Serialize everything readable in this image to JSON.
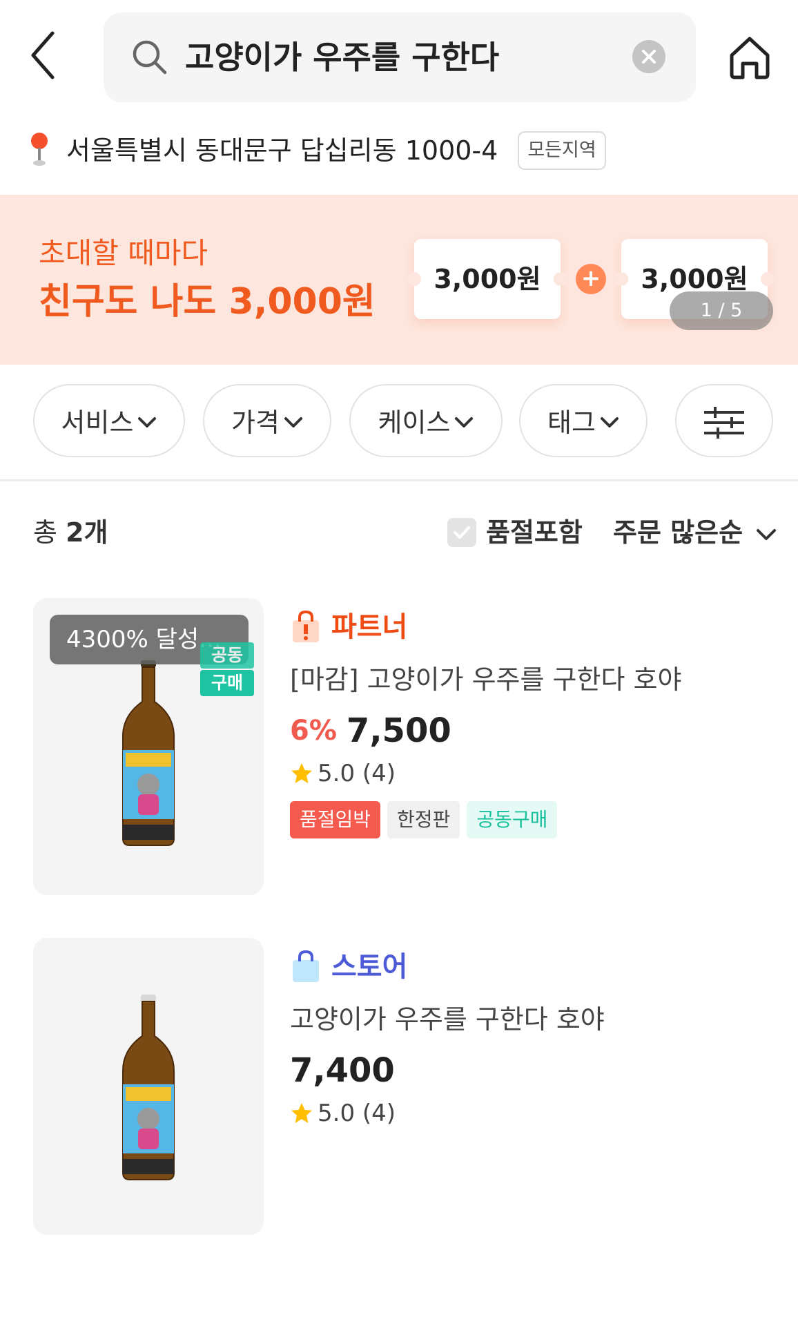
{
  "header": {
    "search_query": "고양이가 우주를 구한다"
  },
  "location": {
    "address": "서울특별시 동대문구 답십리동 1000-4",
    "region_button": "모든지역"
  },
  "banner": {
    "line1": "초대할 때마다",
    "line2": "친구도 나도 3,000원",
    "coupon_left": "3,000원",
    "coupon_right": "3,000원",
    "plus": "+",
    "page_indicator": "1 / 5"
  },
  "filters": {
    "service": "서비스",
    "price": "가격",
    "case": "케이스",
    "tag": "태그"
  },
  "list_header": {
    "total_prefix": "총",
    "total_count": "2개",
    "soldout_label": "품절포함",
    "sort_label": "주문 많은순"
  },
  "products": [
    {
      "achievement": "4300% 달성...",
      "group_tag_top": "공동",
      "group_tag_bottom": "구매",
      "seller_type": "파트너",
      "title": "[마감] 고양이가 우주를 구한다 호야",
      "discount": "6%",
      "price": "7,500",
      "rating": "5.0 (4)",
      "tags": [
        "품절임박",
        "한정판",
        "공동구매"
      ]
    },
    {
      "seller_type": "스토어",
      "title": "고양이가 우주를 구한다 호야",
      "price": "7,400",
      "rating": "5.0 (4)"
    }
  ],
  "colors": {
    "brand_orange": "#f05a1e",
    "banner_bg": "#fde6dd",
    "partner_red": "#ef4b14",
    "store_blue": "#4e5bd6",
    "discount_red": "#f15a4e",
    "group_green": "#1fc5a2"
  },
  "icons": {
    "back": "chevron-left-icon",
    "search": "search-icon",
    "clear": "close-circle-icon",
    "home": "home-icon",
    "location": "map-pin-icon",
    "filter_settings": "sliders-icon",
    "partner": "partner-bag-icon",
    "store": "store-bag-icon",
    "rating": "star-icon"
  }
}
